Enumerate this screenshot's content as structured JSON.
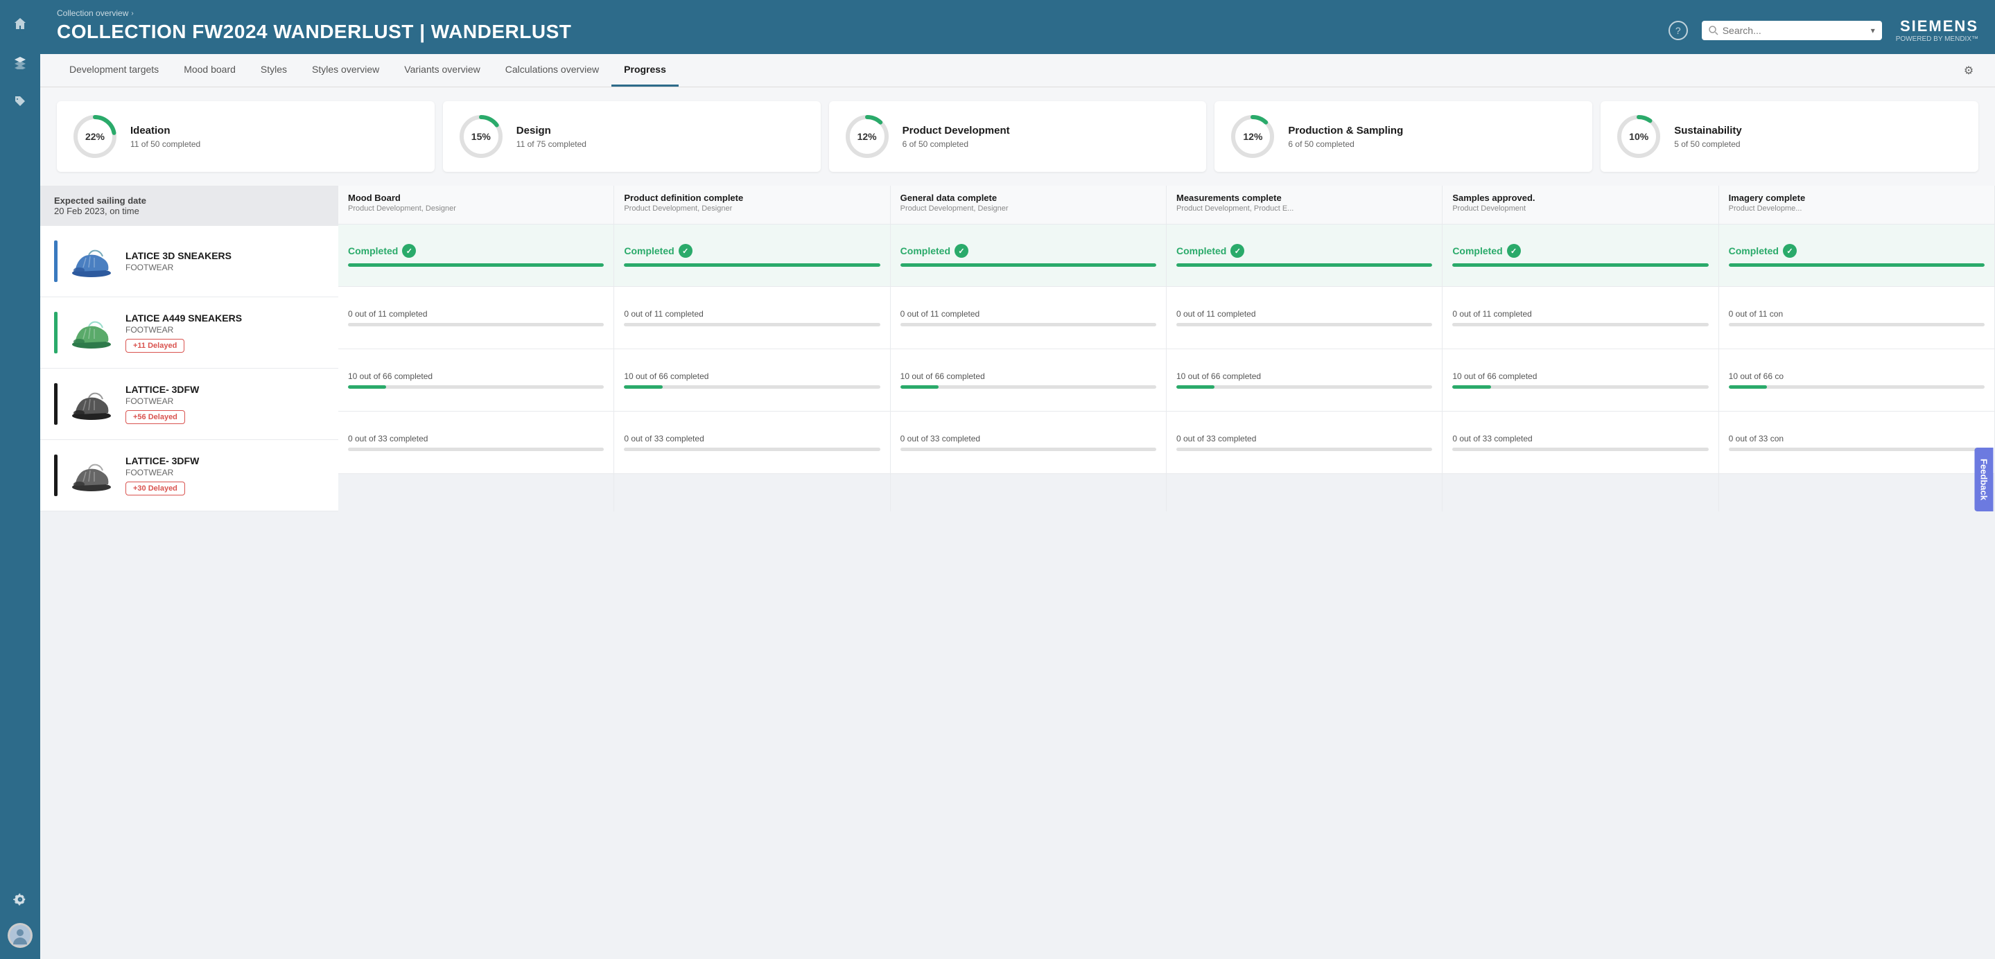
{
  "brand": {
    "name": "SIEMENS",
    "powered": "POWERED BY MENDIX™"
  },
  "breadcrumb": "Collection overview",
  "page_title": "COLLECTION  FW2024 WANDERLUST | WANDERLUST",
  "search": {
    "placeholder": "Search..."
  },
  "nav": {
    "tabs": [
      {
        "id": "dev-targets",
        "label": "Development targets"
      },
      {
        "id": "mood-board",
        "label": "Mood board"
      },
      {
        "id": "styles",
        "label": "Styles"
      },
      {
        "id": "styles-overview",
        "label": "Styles overview"
      },
      {
        "id": "variants-overview",
        "label": "Variants overview"
      },
      {
        "id": "calculations-overview",
        "label": "Calculations overview"
      },
      {
        "id": "progress",
        "label": "Progress"
      }
    ],
    "active": "progress"
  },
  "progress_cards": [
    {
      "label": "Ideation",
      "pct": 22,
      "detail": "11 of 50 completed"
    },
    {
      "label": "Design",
      "pct": 15,
      "detail": "11 of 75 completed"
    },
    {
      "label": "Product Development",
      "pct": 12,
      "detail": "6 of 50 completed"
    },
    {
      "label": "Production & Sampling",
      "pct": 12,
      "detail": "6 of 50 completed"
    },
    {
      "label": "Sustainability",
      "pct": 10,
      "detail": "5 of 50 completed"
    }
  ],
  "table": {
    "left_header": {
      "date_label": "Expected sailing date",
      "date_value": "20 Feb 2023, on time"
    },
    "columns": [
      {
        "title": "Mood Board",
        "sub": "Product Development, Designer"
      },
      {
        "title": "Product definition complete",
        "sub": "Product Development, Designer"
      },
      {
        "title": "General data complete",
        "sub": "Product Development, Designer"
      },
      {
        "title": "Measurements complete",
        "sub": "Product Development, Product E..."
      },
      {
        "title": "Samples approved.",
        "sub": "Product Development"
      },
      {
        "title": "Imagery complete",
        "sub": "Product Developme..."
      }
    ],
    "rows": [
      {
        "name": "LATICE 3D SNEAKERS",
        "category": "FOOTWEAR",
        "color_bar": "#3a7abf",
        "shoe_color": "blue",
        "delay": null,
        "cells": [
          {
            "type": "completed",
            "status": "Completed"
          },
          {
            "type": "completed",
            "status": "Completed"
          },
          {
            "type": "completed",
            "status": "Completed"
          },
          {
            "type": "completed",
            "status": "Completed"
          },
          {
            "type": "completed",
            "status": "Completed"
          },
          {
            "type": "completed",
            "status": "Completed"
          }
        ]
      },
      {
        "name": "LATICE A449 SNEAKERS",
        "category": "FOOTWEAR",
        "color_bar": "#2aaa6a",
        "shoe_color": "green",
        "delay": "+11 Delayed",
        "cells": [
          {
            "type": "progress",
            "text": "0 out of 11 completed",
            "pct": 0
          },
          {
            "type": "progress",
            "text": "0 out of 11 completed",
            "pct": 0
          },
          {
            "type": "progress",
            "text": "0 out of 11 completed",
            "pct": 0
          },
          {
            "type": "progress",
            "text": "0 out of 11 completed",
            "pct": 0
          },
          {
            "type": "progress",
            "text": "0 out of 11 completed",
            "pct": 0
          },
          {
            "type": "progress",
            "text": "0 out of 11 con",
            "pct": 0
          }
        ]
      },
      {
        "name": "LATTICE- 3DFW",
        "category": "FOOTWEAR",
        "color_bar": "#1a1a1a",
        "shoe_color": "dark",
        "delay": "+56 Delayed",
        "cells": [
          {
            "type": "progress",
            "text": "10 out of 66 completed",
            "pct": 15
          },
          {
            "type": "progress",
            "text": "10 out of 66 completed",
            "pct": 15
          },
          {
            "type": "progress",
            "text": "10 out of 66 completed",
            "pct": 15
          },
          {
            "type": "progress",
            "text": "10 out of 66 completed",
            "pct": 15
          },
          {
            "type": "progress",
            "text": "10 out of 66 completed",
            "pct": 15
          },
          {
            "type": "progress",
            "text": "10 out of 66 co",
            "pct": 15
          }
        ]
      },
      {
        "name": "LATTICE- 3DFW",
        "category": "FOOTWEAR",
        "color_bar": "#1a1a1a",
        "shoe_color": "darkgray",
        "delay": "+30 Delayed",
        "cells": [
          {
            "type": "progress",
            "text": "0 out of 33 completed",
            "pct": 0
          },
          {
            "type": "progress",
            "text": "0 out of 33 completed",
            "pct": 0
          },
          {
            "type": "progress",
            "text": "0 out of 33 completed",
            "pct": 0
          },
          {
            "type": "progress",
            "text": "0 out of 33 completed",
            "pct": 0
          },
          {
            "type": "progress",
            "text": "0 out of 33 completed",
            "pct": 0
          },
          {
            "type": "progress",
            "text": "0 out of 33 con",
            "pct": 0
          }
        ]
      }
    ]
  },
  "sidebar": {
    "icons": [
      "home",
      "layers",
      "tag",
      "settings"
    ]
  },
  "feedback_label": "Feedback"
}
